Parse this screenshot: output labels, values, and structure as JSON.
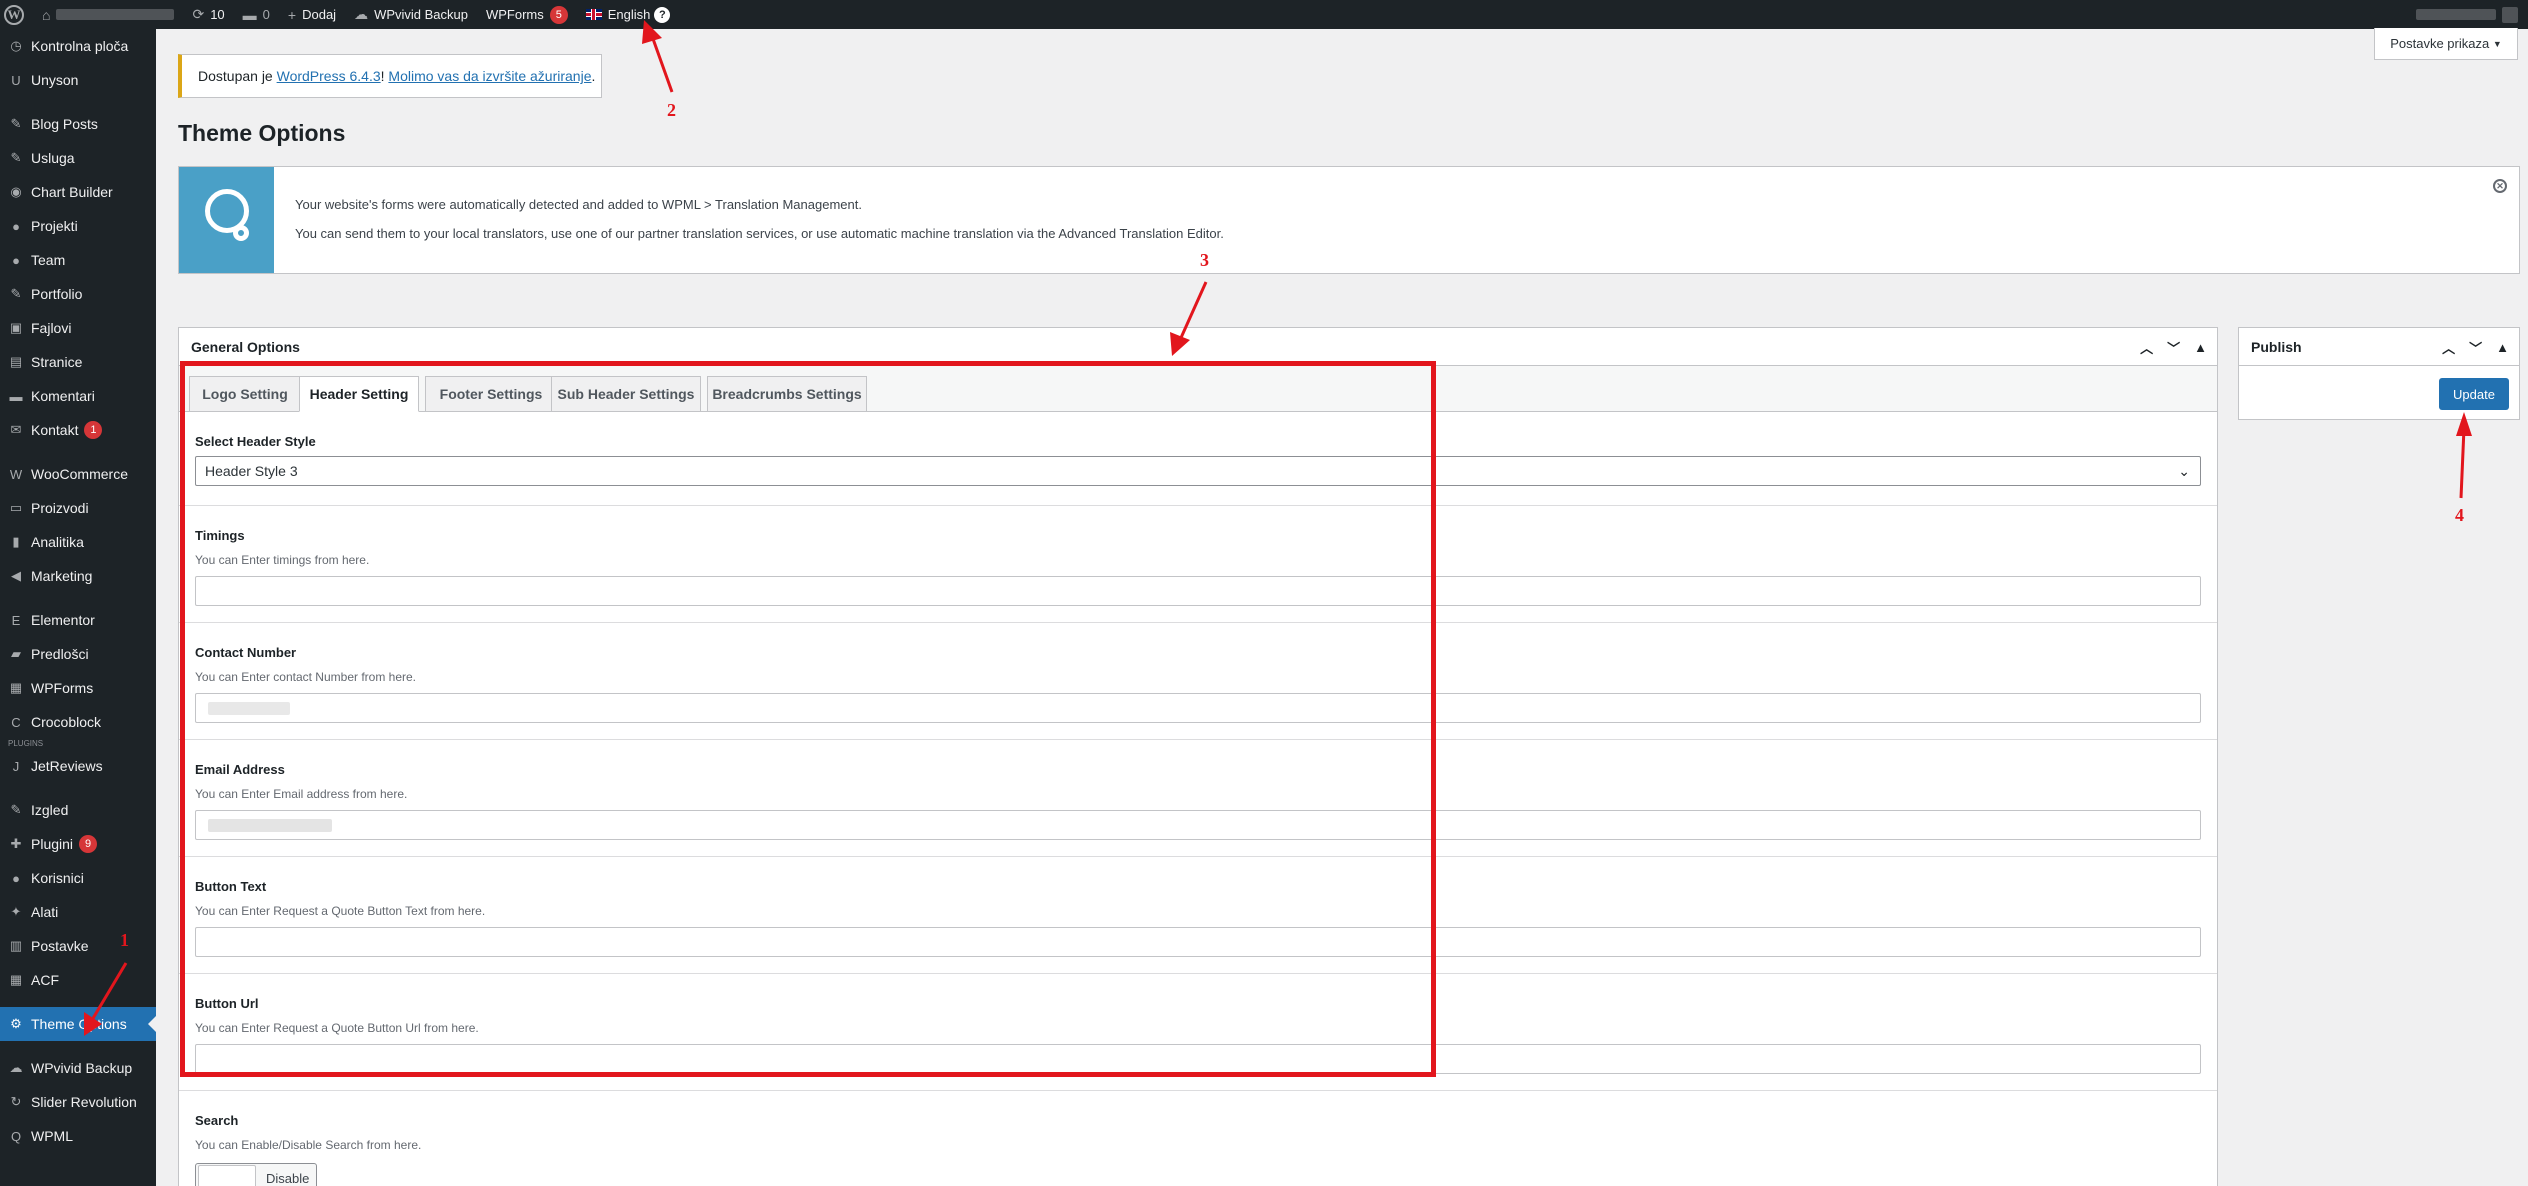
{
  "admin_bar": {
    "updates_count": "10",
    "comments_count": "0",
    "new_label": "Dodaj",
    "backup_label": "WPvivid Backup",
    "wpforms_label": "WPForms",
    "wpforms_badge": "5",
    "language_label": "English",
    "language_badge": "?"
  },
  "sidebar": {
    "items": [
      {
        "label": "Kontrolna ploča",
        "icon": "dashboard-icon"
      },
      {
        "label": "Unyson",
        "icon": "unyson-icon"
      },
      {
        "label": "Blog Posts",
        "icon": "pin-icon"
      },
      {
        "label": "Usluga",
        "icon": "pin-icon"
      },
      {
        "label": "Chart Builder",
        "icon": "chart-builder-icon"
      },
      {
        "label": "Projekti",
        "icon": "user-icon"
      },
      {
        "label": "Team",
        "icon": "user-icon"
      },
      {
        "label": "Portfolio",
        "icon": "pin-icon"
      },
      {
        "label": "Fajlovi",
        "icon": "media-icon"
      },
      {
        "label": "Stranice",
        "icon": "page-icon"
      },
      {
        "label": "Komentari",
        "icon": "comment-icon"
      },
      {
        "label": "Kontakt",
        "icon": "mail-icon",
        "badge": "1"
      },
      {
        "label": "WooCommerce",
        "icon": "woo-icon"
      },
      {
        "label": "Proizvodi",
        "icon": "archive-icon"
      },
      {
        "label": "Analitika",
        "icon": "bar-chart-icon"
      },
      {
        "label": "Marketing",
        "icon": "megaphone-icon"
      },
      {
        "label": "Elementor",
        "icon": "elementor-icon"
      },
      {
        "label": "Predlošci",
        "icon": "folder-icon"
      },
      {
        "label": "WPForms",
        "icon": "form-icon"
      },
      {
        "label": "Crocoblock",
        "icon": "croco-icon"
      },
      {
        "label": "JetReviews",
        "icon": "jet-icon"
      },
      {
        "label": "Izgled",
        "icon": "brush-icon"
      },
      {
        "label": "Plugini",
        "icon": "plugin-icon",
        "badge": "9"
      },
      {
        "label": "Korisnici",
        "icon": "user-icon"
      },
      {
        "label": "Alati",
        "icon": "wrench-icon"
      },
      {
        "label": "Postavke",
        "icon": "settings-icon"
      },
      {
        "label": "ACF",
        "icon": "acf-icon"
      },
      {
        "label": "Theme Options",
        "icon": "gear-icon",
        "current": true
      },
      {
        "label": "WPvivid Backup",
        "icon": "cloud-icon"
      },
      {
        "label": "Slider Revolution",
        "icon": "refresh-icon"
      },
      {
        "label": "WPML",
        "icon": "wpml-icon"
      }
    ],
    "plugin_tag": "PLUGINS"
  },
  "screen_options": "Postavke prikaza",
  "notice": {
    "prefix": "Dostupan je ",
    "link1": "WordPress 6.4.3",
    "middle": "! ",
    "link2": "Molimo vas da izvršite ažuriranje",
    "suffix": "."
  },
  "page_title": "Theme Options",
  "wpml_notice": {
    "line1": "Your website's forms were automatically detected and added to WPML > Translation Management.",
    "line2": "You can send them to your local translators, use one of our partner translation services, or use automatic machine translation via the Advanced Translation Editor."
  },
  "general_options": {
    "title": "General Options",
    "tabs": [
      "Logo Setting",
      "Header Setting",
      "Footer Settings",
      "Sub Header Settings",
      "Breadcrumbs Settings"
    ],
    "active_tab": "Header Setting",
    "fields": {
      "header_style": {
        "label": "Select Header Style",
        "value": "Header Style 3"
      },
      "timings": {
        "label": "Timings",
        "desc": "You can Enter timings from here."
      },
      "contact": {
        "label": "Contact Number",
        "desc": "You can Enter contact Number from here."
      },
      "email": {
        "label": "Email Address",
        "desc": "You can Enter Email address from here."
      },
      "button_text": {
        "label": "Button Text",
        "desc": "You can Enter Request a Quote Button Text from here."
      },
      "button_url": {
        "label": "Button Url",
        "desc": "You can Enter Request a Quote Button Url from here."
      },
      "search": {
        "label": "Search",
        "desc": "You can Enable/Disable Search from here.",
        "toggle_label": "Disable"
      }
    }
  },
  "publish": {
    "title": "Publish",
    "update_label": "Update"
  },
  "annotations": [
    "1",
    "2",
    "3",
    "4"
  ],
  "colors": {
    "accent": "#2271b1",
    "annotation": "#e2161d",
    "adminbar": "#1d2327"
  }
}
